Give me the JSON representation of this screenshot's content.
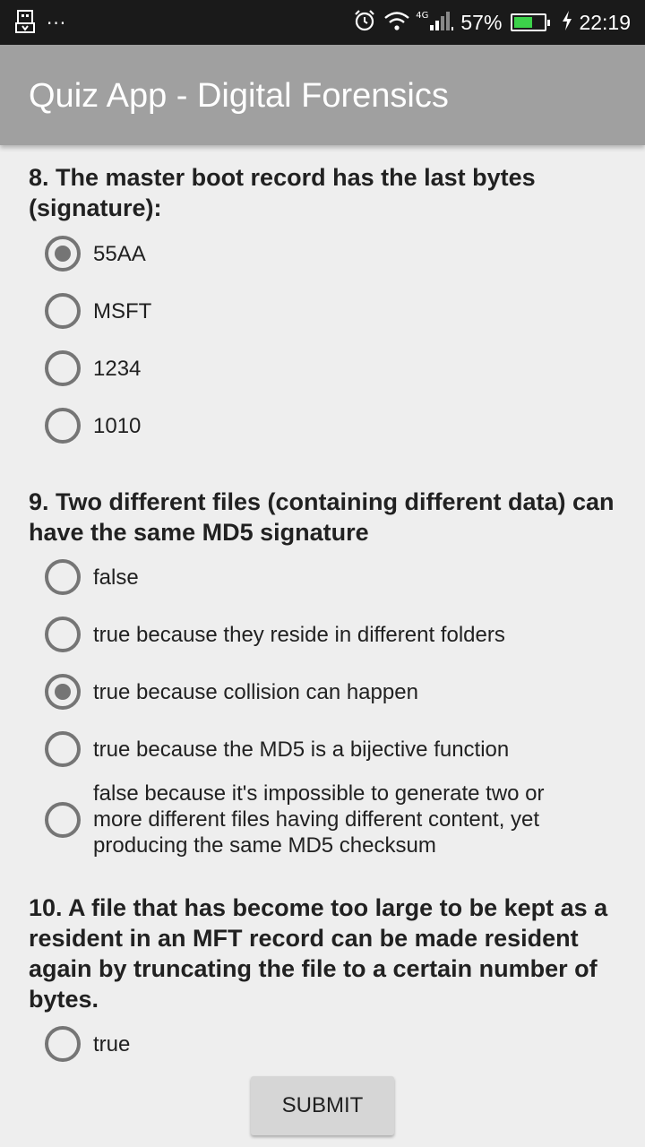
{
  "status_bar": {
    "battery": "57%",
    "time": "22:19",
    "network": "4G",
    "icons": [
      "usb-icon",
      "more-dots-icon",
      "alarm-icon",
      "wifi-icon",
      "signal-icon",
      "battery-icon",
      "charging-icon"
    ],
    "battery_color": "#3cd24a"
  },
  "app_bar": {
    "title": "Quiz App - Digital Forensics",
    "color": "#a0a0a0"
  },
  "questions": [
    {
      "text": "8. The master boot record has the last bytes (signature):",
      "options": [
        {
          "label": "55AA",
          "checked": true
        },
        {
          "label": "MSFT",
          "checked": false
        },
        {
          "label": "1234",
          "checked": false
        },
        {
          "label": "1010",
          "checked": false
        }
      ]
    },
    {
      "text": "9. Two different files (containing different data) can have the same MD5 signature",
      "options": [
        {
          "label": "false",
          "checked": false
        },
        {
          "label": "true because they reside in different folders",
          "checked": false
        },
        {
          "label": "true because collision can happen",
          "checked": true
        },
        {
          "label": "true because the MD5 is a bijective function",
          "checked": false
        },
        {
          "label": "false because it's impossible to generate two or more different files having different content, yet producing the same MD5 checksum",
          "checked": false
        }
      ]
    },
    {
      "text": "10. A file that has become too large to be kept as a resident in an MFT record can be made resident again by truncating the file to a certain number of bytes.",
      "options": [
        {
          "label": "true",
          "checked": false
        }
      ]
    }
  ],
  "submit_label": "SUBMIT"
}
